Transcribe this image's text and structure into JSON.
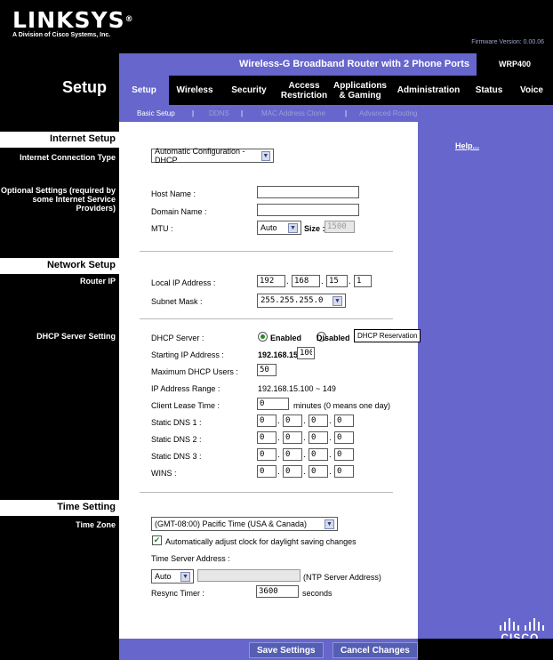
{
  "header": {
    "logo": "LINKSYS",
    "logo_mark": "®",
    "logo_sub": "A Division of Cisco Systems, Inc.",
    "firmware": "Firmware Version: 0.00.06"
  },
  "product": {
    "name": "Wireless-G Broadband Router with 2 Phone Ports",
    "model": "WRP400"
  },
  "section_title": "Setup",
  "tabs": [
    "Setup",
    "Wireless",
    "Security",
    "Access Restriction",
    "Applications & Gaming",
    "Administration",
    "Status",
    "Voice"
  ],
  "subtabs": [
    "Basic Setup",
    "DDNS",
    "MAC Address Clone",
    "Advanced Routing"
  ],
  "sub_separator": "|",
  "help_link": "Help...",
  "brand_footer": "CISCO.",
  "internet": {
    "section": "Internet Setup",
    "conn_type_label": "Internet Connection Type",
    "conn_type_value": "Automatic Configuration - DHCP",
    "optional_label": "Optional Settings (required by some Internet Service Providers)",
    "host_name_label": "Host Name :",
    "host_name_value": "",
    "domain_name_label": "Domain Name :",
    "domain_name_value": "",
    "mtu_label": "MTU :",
    "mtu_value": "Auto",
    "size_label": "Size :",
    "size_value": "1500"
  },
  "network": {
    "section": "Network Setup",
    "router_ip_label": "Router IP",
    "local_ip_label": "Local IP Address :",
    "local_ip": [
      "192",
      "168",
      "15",
      "1"
    ],
    "subnet_label": "Subnet Mask :",
    "subnet_value": "255.255.255.0",
    "dhcp_setting_label": "DHCP Server Setting",
    "dhcp_server_label": "DHCP Server :",
    "enabled_label": "Enabled",
    "disabled_label": "Disabled",
    "reservation_button": "DHCP Reservation",
    "start_ip_label": "Starting IP Address :",
    "start_ip_prefix": "192.168.15.",
    "start_ip_value": "100",
    "max_users_label": "Maximum DHCP Users :",
    "max_users_value": "50",
    "ip_range_label": "IP Address Range :",
    "ip_range_value": "192.168.15.100 ~ 149",
    "lease_label": "Client Lease Time :",
    "lease_value": "0",
    "lease_unit": "minutes (0 means one day)",
    "dns1_label": "Static DNS 1 :",
    "dns1": [
      "0",
      "0",
      "0",
      "0"
    ],
    "dns2_label": "Static DNS 2 :",
    "dns2": [
      "0",
      "0",
      "0",
      "0"
    ],
    "dns3_label": "Static DNS 3 :",
    "dns3": [
      "0",
      "0",
      "0",
      "0"
    ],
    "wins_label": "WINS :",
    "wins": [
      "0",
      "0",
      "0",
      "0"
    ]
  },
  "time": {
    "section": "Time Setting",
    "zone_label": "Time Zone",
    "zone_value": "(GMT-08:00) Pacific Time (USA & Canada)",
    "dst_label": "Automatically adjust clock for daylight saving changes",
    "server_label": "Time Server Address :",
    "server_mode": "Auto",
    "server_value": "",
    "ntp_label": "(NTP Server Address)",
    "resync_label": "Resync Timer :",
    "resync_value": "3600",
    "resync_unit": "seconds"
  },
  "footer": {
    "save": "Save Settings",
    "cancel": "Cancel Changes"
  },
  "colors": {
    "accent": "#6666cc",
    "black": "#000000"
  }
}
